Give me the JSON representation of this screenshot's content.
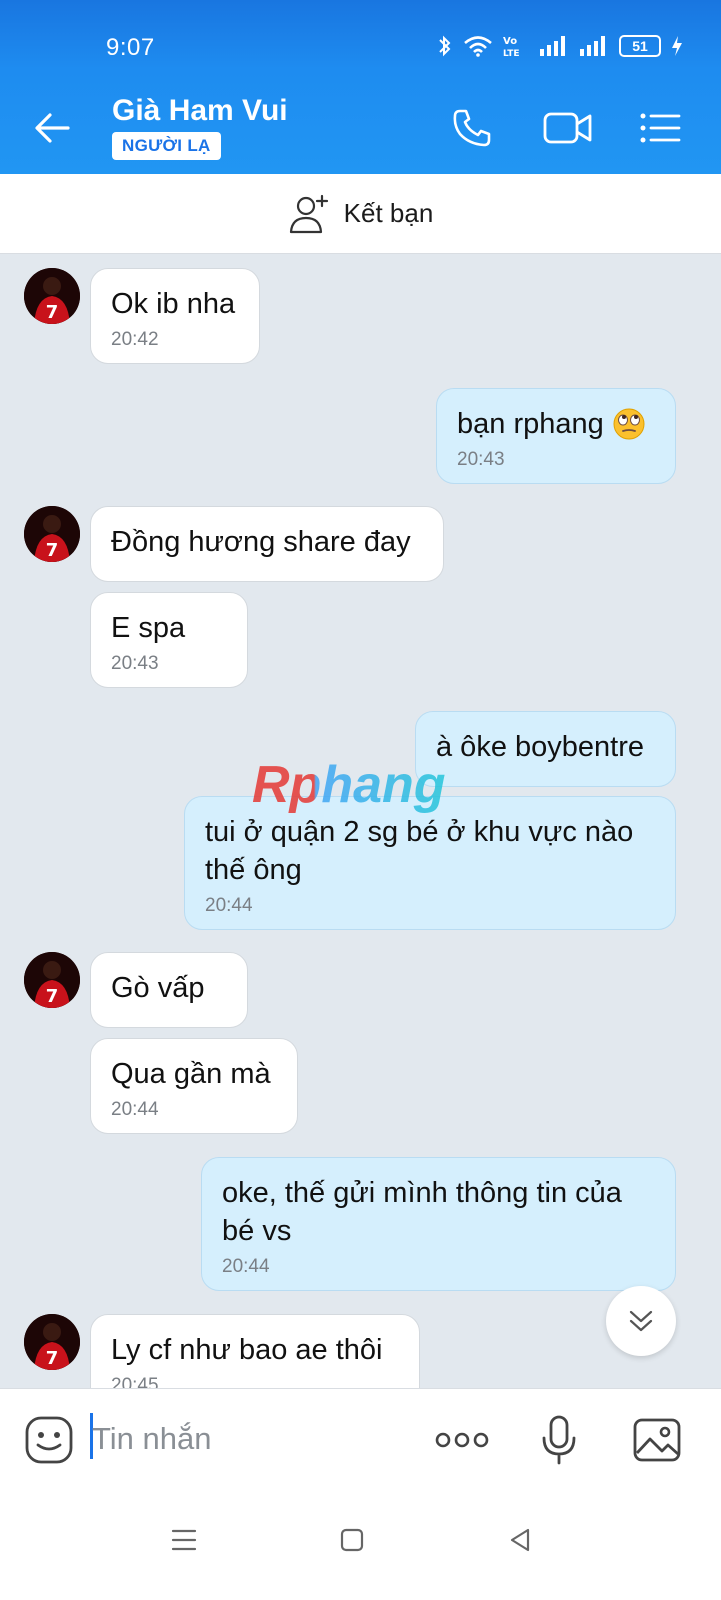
{
  "status": {
    "time": "9:07",
    "battery": "51"
  },
  "header": {
    "contact_name": "Già Ham Vui",
    "badge": "NGƯỜI LẠ"
  },
  "addfriend": {
    "label": "Kết bạn"
  },
  "watermark": "Rphang",
  "messages": [
    {
      "dir": "in",
      "text": "Ok ib nha",
      "time": "20:42"
    },
    {
      "dir": "out",
      "text": "bạn rphang",
      "time": "20:43"
    },
    {
      "dir": "in",
      "text": "Đồng hương share đay",
      "time": ""
    },
    {
      "dir": "in",
      "text": "E spa",
      "time": "20:43"
    },
    {
      "dir": "out",
      "text": "à ôke boybentre",
      "time": ""
    },
    {
      "dir": "out",
      "line1": "tui ở quận 2 sg bé ở khu vực nào",
      "line2": "thế ông",
      "time": "20:44"
    },
    {
      "dir": "in",
      "text": "Gò vấp",
      "time": ""
    },
    {
      "dir": "in",
      "text": "Qua gần mà",
      "time": "20:44"
    },
    {
      "dir": "out",
      "line1": "oke, thế gửi mình thông tin của",
      "line2": "bé vs",
      "time": "20:44"
    },
    {
      "dir": "in",
      "text": "Ly cf như bao ae thôi",
      "time": "20:45"
    }
  ],
  "composer": {
    "placeholder": "Tin nhắn"
  },
  "colors": {
    "header": "#1e8cf0",
    "incoming": "#ffffff",
    "outgoing": "#d5effd",
    "background": "#e2e8ee"
  }
}
